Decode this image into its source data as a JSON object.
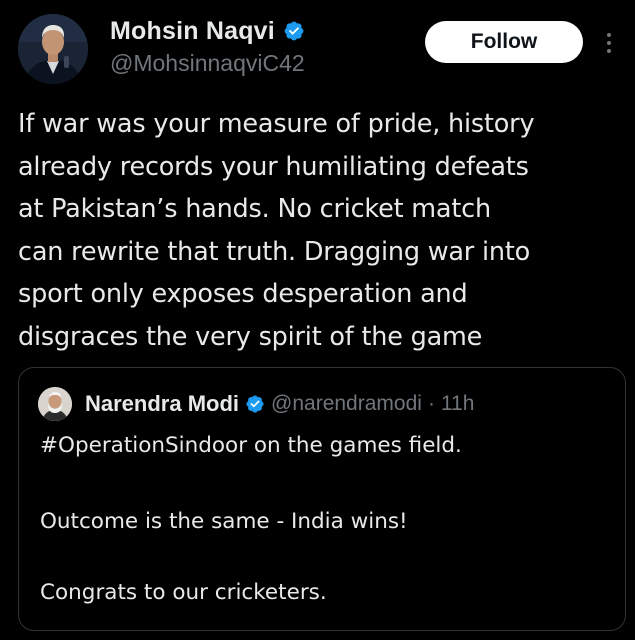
{
  "author": {
    "name": "Mohsin Naqvi",
    "handle": "@MohsinnaqviC42",
    "verified": true
  },
  "follow_button": {
    "label": "Follow"
  },
  "tweet": {
    "text": "If war was your measure of pride, history\nalready records your humiliating defeats\nat Pakistan’s hands. No cricket match\ncan rewrite that truth. Dragging war into\nsport only exposes desperation and\ndisgraces the very spirit of the game"
  },
  "quoted_tweet": {
    "author_name": "Narendra Modi",
    "handle": "@narendramodi",
    "separator": "·",
    "time": "11h",
    "lines": [
      "#OperationSindoor on the games field.",
      "Outcome is the same - India wins!",
      "Congrats to our cricketers."
    ]
  },
  "icons": {
    "verified": "verified-badge-icon",
    "more": "more-options-icon"
  },
  "colors": {
    "background": "#000000",
    "text_primary": "#e7e9ea",
    "text_secondary": "#71767b",
    "verified_blue": "#1d9bf0",
    "button_bg": "#ffffff",
    "border": "#2f3336"
  }
}
